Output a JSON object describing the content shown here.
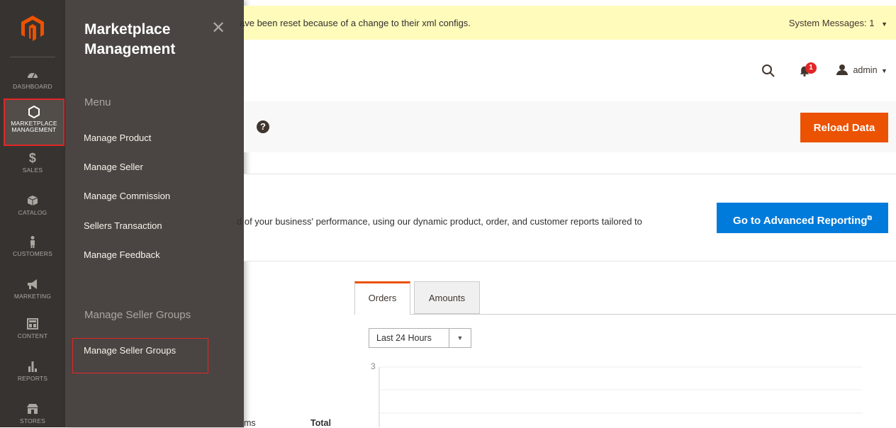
{
  "system_message": {
    "text": "ave been reset because of a change to their xml configs.",
    "label": "System Messages: 1"
  },
  "header": {
    "notifications_count": "1",
    "user": "admin"
  },
  "nav": {
    "items": [
      {
        "label": "DASHBOARD",
        "icon": "dashboard-icon"
      },
      {
        "label": "MARKETPLACE MANAGEMENT",
        "icon": "hexagon-icon"
      },
      {
        "label": "SALES",
        "icon": "dollar-icon"
      },
      {
        "label": "CATALOG",
        "icon": "box-icon"
      },
      {
        "label": "CUSTOMERS",
        "icon": "person-icon"
      },
      {
        "label": "MARKETING",
        "icon": "megaphone-icon"
      },
      {
        "label": "CONTENT",
        "icon": "layout-icon"
      },
      {
        "label": "REPORTS",
        "icon": "bar-chart-icon"
      },
      {
        "label": "STORES",
        "icon": "store-icon"
      }
    ]
  },
  "flyout": {
    "title": "Marketplace Management",
    "section1": "Menu",
    "links": [
      "Manage Product",
      "Manage Seller",
      "Manage Commission",
      "Sellers Transaction",
      "Manage Feedback"
    ],
    "section2": "Manage Seller Groups",
    "group_link": "Manage Seller Groups"
  },
  "actions": {
    "reload_label": "Reload Data"
  },
  "reporting": {
    "text": "d of your business' performance, using our dynamic product, order, and customer reports tailored to",
    "button": "Go to Advanced Reporting"
  },
  "tabs": [
    "Orders",
    "Amounts"
  ],
  "period": {
    "selected": "Last 24 Hours"
  },
  "chart": {
    "y_top_tick": "3"
  },
  "table": {
    "col1": "ms",
    "col2": "Total"
  }
}
